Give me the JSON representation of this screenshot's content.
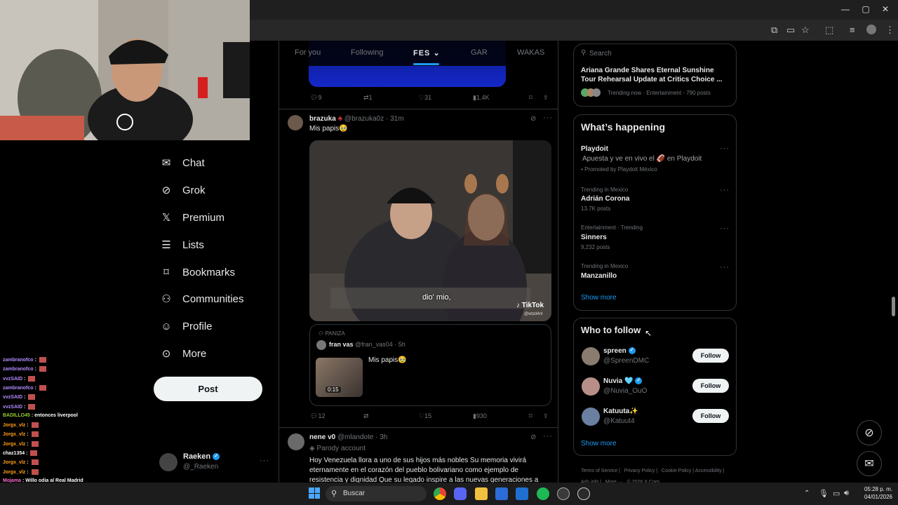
{
  "browser": {
    "window_controls": [
      "—",
      "▢",
      "✕"
    ]
  },
  "tabs": [
    "For you",
    "Following",
    "FES",
    "GAR",
    "WAKAS"
  ],
  "nav": [
    {
      "label": "Chat",
      "icon": "mail-icon"
    },
    {
      "label": "Grok",
      "icon": "grok-icon"
    },
    {
      "label": "Premium",
      "icon": "x-logo-icon"
    },
    {
      "label": "Lists",
      "icon": "list-icon"
    },
    {
      "label": "Bookmarks",
      "icon": "bookmark-icon"
    },
    {
      "label": "Communities",
      "icon": "communities-icon"
    },
    {
      "label": "Profile",
      "icon": "person-icon"
    },
    {
      "label": "More",
      "icon": "more-circle-icon"
    }
  ],
  "post_button": "Post",
  "account": {
    "name": "Raeken",
    "handle": "@_Raeken"
  },
  "chat": [
    {
      "user": "zambranofco",
      "msg": "",
      "color": "#b48cff"
    },
    {
      "user": "zambranofco",
      "msg": "",
      "color": "#b48cff"
    },
    {
      "user": "vvzSAID",
      "msg": "",
      "color": "#b48cff"
    },
    {
      "user": "zambranofco",
      "msg": "",
      "color": "#b48cff"
    },
    {
      "user": "vvzSAID",
      "msg": "",
      "color": "#b48cff"
    },
    {
      "user": "vvzSAID",
      "msg": "",
      "color": "#b48cff"
    },
    {
      "user": "BADILLO45",
      "msg": "entonces liverpool",
      "color": "#9acd32"
    },
    {
      "user": "Jorgx_vlz",
      "msg": "",
      "color": "#ff9f1a"
    },
    {
      "user": "Jorgx_vlz",
      "msg": "",
      "color": "#ff9f1a"
    },
    {
      "user": "Jorgx_vlz",
      "msg": "",
      "color": "#ff9f1a"
    },
    {
      "user": "chaz1354",
      "msg": "",
      "color": "#ffffff"
    },
    {
      "user": "Jorgx_vlz",
      "msg": "",
      "color": "#ff9f1a"
    },
    {
      "user": "Jorgx_vlz",
      "msg": "",
      "color": "#ff9f1a"
    },
    {
      "user": "Mojama",
      "msg": "Willo odia al Real Madrid",
      "color": "#ff6fd0"
    },
    {
      "user": "ELMACKA010",
      "msg": "",
      "color": "#6fb3ff"
    },
    {
      "user": "ELMACKA010",
      "msg": "",
      "color": "#6fb3ff"
    }
  ],
  "prev_post_actions": {
    "replies": "9",
    "reposts": "1",
    "likes": "31",
    "views": "1.4K"
  },
  "post1": {
    "name": "brazuka",
    "handle": "@brazuka0z",
    "time": "· 31m",
    "text": "Mis papis🥹",
    "video_caption": "dio' mio,",
    "tiktok": "TikTok",
    "tiktok_handle": "@wtzd4nl",
    "quote": {
      "label": "PANIZA",
      "name": "fran vas",
      "handle": "@fran_vas04",
      "time": "· 5h",
      "text": "Mis papis🥹",
      "duration": "0:15"
    },
    "actions": {
      "replies": "12",
      "reposts": "",
      "likes": "15",
      "views": "930"
    }
  },
  "post2": {
    "name": "nene v0",
    "handle": "@mlandote",
    "time": "· 3h",
    "badge": "Parody account",
    "text": "Hoy Venezuela llora a uno de sus hijos más nobles Su memoria vivirá eternamente en el corazón del pueblo bolivariano como ejemplo de resistencia y dignidad Que su legado inspire a las nuevas generaciones a"
  },
  "search_placeholder": "Search",
  "top_trend": {
    "title": "Ariana Grande Shares Eternal Sunshine Tour Rehearsal Update at Critics Choice ...",
    "meta": "Trending now · Entertainment · 790 posts"
  },
  "happening": {
    "heading": "What’s happening",
    "promo": {
      "title": "Playdoit",
      "text": "Apuesta y ve en vivo el 🏈 en Playdoit",
      "promoted": "Promoted by Playdoit México"
    },
    "trends": [
      {
        "context": "Trending in Mexico",
        "name": "Adrián Corona",
        "count": "13.7K posts"
      },
      {
        "context": "Entertainment · Trending",
        "name": "Sinners",
        "count": "9,232 posts"
      },
      {
        "context": "Trending in Mexico",
        "name": "Manzanillo",
        "count": ""
      }
    ],
    "show_more": "Show more"
  },
  "who_to_follow": {
    "heading": "Who to follow",
    "users": [
      {
        "name": "spreen",
        "handle": "@SpreenDMC",
        "follow": "Follow"
      },
      {
        "name": "Nuvia 🩵",
        "handle": "@Nuvia_OuO",
        "follow": "Follow"
      },
      {
        "name": "Katuuta✨",
        "handle": "@Katuut4",
        "follow": "Follow"
      }
    ],
    "show_more": "Show more"
  },
  "footer": {
    "links": [
      "Terms of Service",
      "Privacy Policy",
      "Cookie Policy",
      "Accessibility",
      "Ads info",
      "More ···",
      "© 2026 X Corp."
    ]
  },
  "taskbar": {
    "search": "Buscar",
    "time": "05:28 p. m.",
    "date": "04/01/2026"
  }
}
